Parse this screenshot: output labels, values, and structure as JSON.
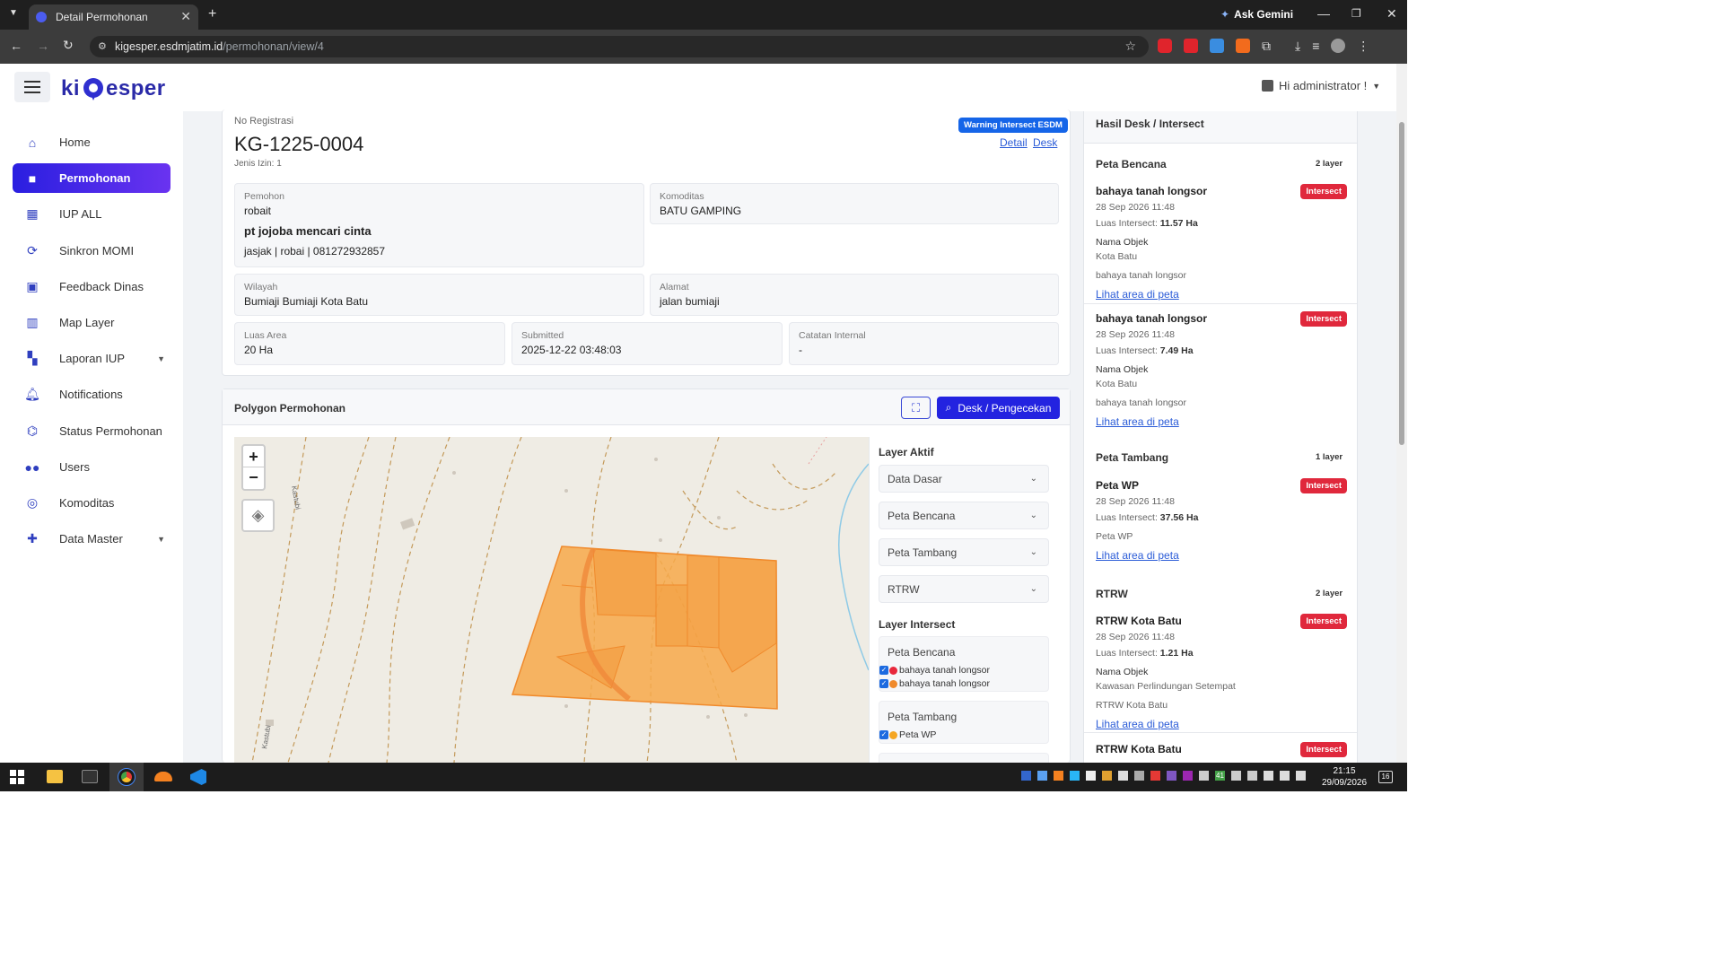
{
  "browser": {
    "tab_title": "Detail Permohonan",
    "url_host": "kigesper.esdmjatim.id",
    "url_path": "/permohonan/view/4",
    "ask_gemini": "Ask Gemini"
  },
  "app": {
    "logo": "kiGesper",
    "user_greeting": "Hi administrator !"
  },
  "sidebar": {
    "items": [
      {
        "label": "Home",
        "icon": "home-icon"
      },
      {
        "label": "Permohonan",
        "icon": "briefcase-icon"
      },
      {
        "label": "IUP ALL",
        "icon": "table-icon"
      },
      {
        "label": "Sinkron MOMI",
        "icon": "sync-icon"
      },
      {
        "label": "Feedback Dinas",
        "icon": "clipboard-icon"
      },
      {
        "label": "Map Layer",
        "icon": "map-icon"
      },
      {
        "label": "Laporan IUP",
        "icon": "dashboard-icon"
      },
      {
        "label": "Notifications",
        "icon": "bell-icon"
      },
      {
        "label": "Status Permohonan",
        "icon": "router-icon"
      },
      {
        "label": "Users",
        "icon": "users-icon"
      },
      {
        "label": "Komoditas",
        "icon": "komoditas-icon"
      },
      {
        "label": "Data Master",
        "icon": "puzzle-icon"
      }
    ]
  },
  "detail": {
    "reg_label": "No Registrasi",
    "reg_no": "KG-1225-0004",
    "jenis_izin": "Jenis Izin: 1",
    "warning_badge": "Warning Intersect ESDM",
    "link_detail": "Detail",
    "link_desk": "Desk",
    "pemohon_label": "Pemohon",
    "pemohon_name": "robait",
    "company": "pt jojoba mencari cinta",
    "contact": "jasjak | robai | 081272932857",
    "komoditas_label": "Komoditas",
    "komoditas": "BATU GAMPING",
    "wilayah_label": "Wilayah",
    "wilayah": "Bumiaji Bumiaji Kota Batu",
    "alamat_label": "Alamat",
    "alamat": "jalan bumiaji",
    "luas_label": "Luas Area",
    "luas": "20 Ha",
    "submitted_label": "Submitted",
    "submitted": "2025-12-22 03:48:03",
    "catatan_label": "Catatan Internal",
    "catatan": "-"
  },
  "polygon": {
    "title": "Polygon Permohonan",
    "desk_button": "Desk / Pengecekan",
    "zoom_in": "+",
    "zoom_out": "−",
    "map_label_1": "Kastubi",
    "map_label_2": "Kastubi",
    "polygon_fill": "#f7a94a",
    "polygon_stroke": "#f08a2c"
  },
  "layers": {
    "active_title": "Layer Aktif",
    "active": [
      "Data Dasar",
      "Peta Bencana",
      "Peta Tambang",
      "RTRW"
    ],
    "intersect_title": "Layer Intersect",
    "groups": [
      {
        "name": "Peta Bencana",
        "items": [
          {
            "label": "bahaya tanah longsor",
            "color": "#e8283c"
          },
          {
            "label": "bahaya tanah longsor",
            "color": "#f08a2c"
          }
        ]
      },
      {
        "name": "Peta Tambang",
        "items": [
          {
            "label": "Peta WP",
            "color": "#f5a623"
          }
        ]
      }
    ]
  },
  "hasil": {
    "title": "Hasil Desk / Intersect",
    "badge": "Intersect",
    "nama_objek_label": "Nama Objek",
    "lihat": "Lihat area di peta",
    "sections": [
      {
        "name": "Peta Bencana",
        "count": "2 layer",
        "items": [
          {
            "title": "bahaya tanah longsor",
            "date": "28 Sep 2026 11:48",
            "luas_label": "Luas Intersect:",
            "luas": "11.57 Ha",
            "obj": "Kota Batu",
            "layer": "bahaya tanah longsor"
          },
          {
            "title": "bahaya tanah longsor",
            "date": "28 Sep 2026 11:48",
            "luas_label": "Luas Intersect:",
            "luas": "7.49 Ha",
            "obj": "Kota Batu",
            "layer": "bahaya tanah longsor"
          }
        ]
      },
      {
        "name": "Peta Tambang",
        "count": "1 layer",
        "items": [
          {
            "title": "Peta WP",
            "date": "28 Sep 2026 11:48",
            "luas_label": "Luas Intersect:",
            "luas": "37.56 Ha",
            "layer": "Peta WP"
          }
        ]
      },
      {
        "name": "RTRW",
        "count": "2 layer",
        "items": [
          {
            "title": "RTRW Kota Batu",
            "date": "28 Sep 2026 11:48",
            "luas_label": "Luas Intersect:",
            "luas": "1.21 Ha",
            "obj": "Kawasan Perlindungan Setempat",
            "layer": "RTRW Kota Batu"
          },
          {
            "title": "RTRW Kota Batu"
          }
        ]
      }
    ]
  },
  "taskbar": {
    "time": "21:15",
    "date": "29/09/2026",
    "notif_count": "16",
    "tray_badge": "41"
  }
}
